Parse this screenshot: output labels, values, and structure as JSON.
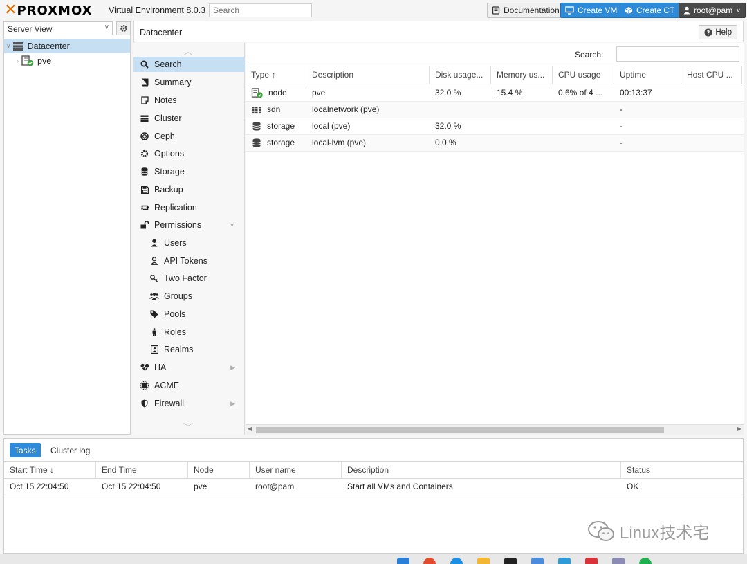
{
  "header": {
    "logo_text": "PROXMOX",
    "version": "Virtual Environment 8.0.3",
    "search_placeholder": "Search",
    "documentation_label": "Documentation",
    "create_vm_label": "Create VM",
    "create_ct_label": "Create CT",
    "user_label": "root@pam"
  },
  "tree": {
    "view": "Server View",
    "items": [
      {
        "label": "Datacenter",
        "icon": "server-rack-icon",
        "selected": true
      },
      {
        "label": "pve",
        "icon": "node-online-icon",
        "selected": false
      }
    ]
  },
  "content": {
    "title": "Datacenter",
    "help_label": "Help"
  },
  "nav": {
    "items": [
      {
        "label": "Search",
        "icon": "search-icon",
        "selected": true,
        "indent": false
      },
      {
        "label": "Summary",
        "icon": "book-icon",
        "indent": false
      },
      {
        "label": "Notes",
        "icon": "note-icon",
        "indent": false
      },
      {
        "label": "Cluster",
        "icon": "cluster-icon",
        "indent": false
      },
      {
        "label": "Ceph",
        "icon": "ceph-icon",
        "indent": false
      },
      {
        "label": "Options",
        "icon": "gear-icon",
        "indent": false
      },
      {
        "label": "Storage",
        "icon": "database-icon",
        "indent": false
      },
      {
        "label": "Backup",
        "icon": "floppy-icon",
        "indent": false
      },
      {
        "label": "Replication",
        "icon": "retweet-icon",
        "indent": false
      },
      {
        "label": "Permissions",
        "icon": "unlock-icon",
        "indent": false,
        "expander": "down"
      },
      {
        "label": "Users",
        "icon": "user-icon",
        "indent": true
      },
      {
        "label": "API Tokens",
        "icon": "user-outline-icon",
        "indent": true
      },
      {
        "label": "Two Factor",
        "icon": "key-icon",
        "indent": true
      },
      {
        "label": "Groups",
        "icon": "users-icon",
        "indent": true
      },
      {
        "label": "Pools",
        "icon": "tags-icon",
        "indent": true
      },
      {
        "label": "Roles",
        "icon": "male-icon",
        "indent": true
      },
      {
        "label": "Realms",
        "icon": "address-book-icon",
        "indent": true
      },
      {
        "label": "HA",
        "icon": "heartbeat-icon",
        "indent": false,
        "expander": "right"
      },
      {
        "label": "ACME",
        "icon": "certificate-icon",
        "indent": false
      },
      {
        "label": "Firewall",
        "icon": "shield-icon",
        "indent": false,
        "expander": "right"
      }
    ]
  },
  "grid": {
    "search_label": "Search:",
    "columns": [
      "Type ↑",
      "Description",
      "Disk usage...",
      "Memory us...",
      "CPU usage",
      "Uptime",
      "Host CPU ..."
    ],
    "rows": [
      {
        "type": "node",
        "icon": "node-online-icon",
        "description": "pve",
        "disk": "32.0 %",
        "memory": "15.4 %",
        "cpu": "0.6% of 4 ...",
        "uptime": "00:13:37",
        "hostcpu": ""
      },
      {
        "type": "sdn",
        "icon": "grid-icon",
        "description": "localnetwork (pve)",
        "disk": "",
        "memory": "",
        "cpu": "",
        "uptime": "-",
        "hostcpu": ""
      },
      {
        "type": "storage",
        "icon": "database-icon",
        "description": "local (pve)",
        "disk": "32.0 %",
        "memory": "",
        "cpu": "",
        "uptime": "-",
        "hostcpu": ""
      },
      {
        "type": "storage",
        "icon": "database-icon",
        "description": "local-lvm (pve)",
        "disk": "0.0 %",
        "memory": "",
        "cpu": "",
        "uptime": "-",
        "hostcpu": ""
      }
    ]
  },
  "bottom": {
    "tabs": [
      "Tasks",
      "Cluster log"
    ],
    "columns": [
      "Start Time ↓",
      "End Time",
      "Node",
      "User name",
      "Description",
      "Status"
    ],
    "rows": [
      {
        "start": "Oct 15 22:04:50",
        "end": "Oct 15 22:04:50",
        "node": "pve",
        "user": "root@pam",
        "description": "Start all VMs and Containers",
        "status": "OK"
      }
    ]
  },
  "watermark": "Linux技术宅",
  "colors": {
    "accent": "#2d8ad8",
    "brand_orange": "#e57000",
    "selection": "#c7dff3",
    "online": "#3aa53a"
  }
}
